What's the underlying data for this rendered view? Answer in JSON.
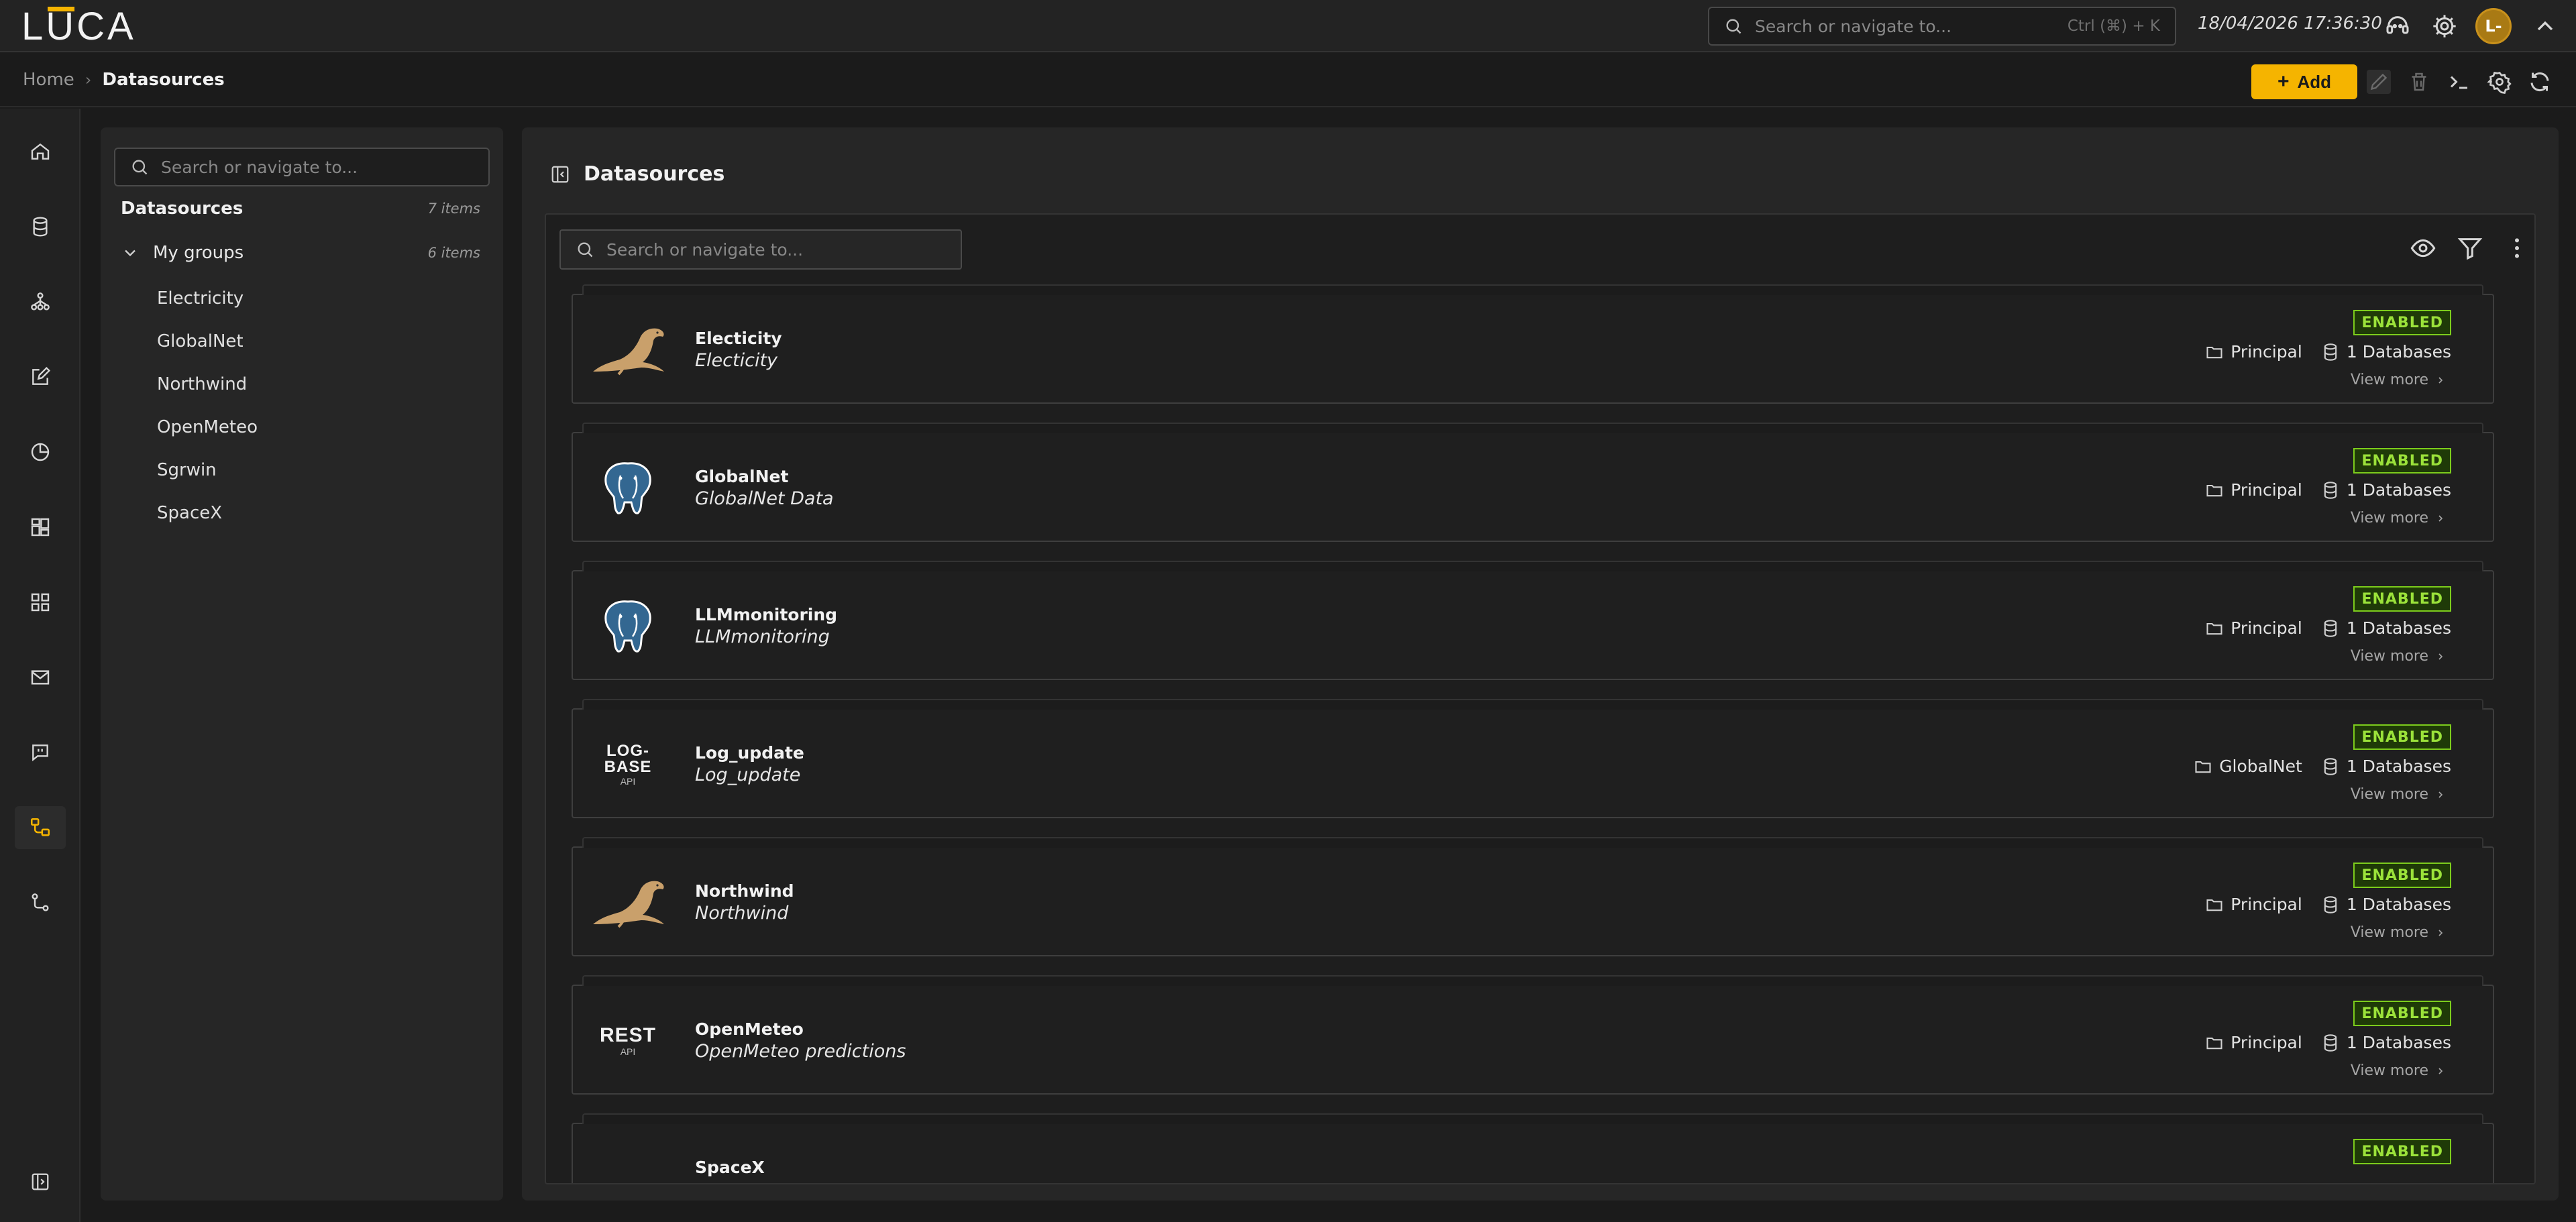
{
  "app": {
    "logo": "LUCA",
    "datetime": "18/04/2026 17:36:30",
    "avatar": "L-"
  },
  "global_search": {
    "placeholder": "Search or navigate to...",
    "shortcut": "Ctrl (⌘) + K"
  },
  "breadcrumb": {
    "home": "Home",
    "separator": "›",
    "current": "Datasources"
  },
  "toolbar": {
    "add_label": "Add"
  },
  "rail": {
    "items": [
      "home-icon",
      "database-icon",
      "hierarchy-icon",
      "edit-icon",
      "pie-chart-icon",
      "dashboard-icon",
      "grid-icon",
      "mail-icon",
      "chat-icon",
      "datasources-icon",
      "workflow-icon"
    ],
    "active": "datasources-icon"
  },
  "tree": {
    "search_placeholder": "Search or navigate to...",
    "root": {
      "label": "Datasources",
      "count": "7 items"
    },
    "group": {
      "label": "My groups",
      "count": "6 items"
    },
    "leaves": [
      "Electricity",
      "GlobalNet",
      "Northwind",
      "OpenMeteo",
      "Sgrwin",
      "SpaceX"
    ]
  },
  "main": {
    "title": "Datasources",
    "search_placeholder": "Search or navigate to...",
    "cards": [
      {
        "name": "Electicity",
        "description": "Electicity",
        "status": "ENABLED",
        "group": "Principal",
        "databases": "1 Databases",
        "view_more": "View more",
        "logo": "mysql-icon"
      },
      {
        "name": "GlobalNet",
        "description": "GlobalNet Data",
        "status": "ENABLED",
        "group": "Principal",
        "databases": "1 Databases",
        "view_more": "View more",
        "logo": "postgresql-icon"
      },
      {
        "name": "LLMmonitoring",
        "description": "LLMmonitoring",
        "status": "ENABLED",
        "group": "Principal",
        "databases": "1 Databases",
        "view_more": "View more",
        "logo": "postgresql-icon"
      },
      {
        "name": "Log_update",
        "description": "Log_update",
        "status": "ENABLED",
        "group": "GlobalNet",
        "databases": "1 Databases",
        "view_more": "View more",
        "logo": "log-base-logo",
        "logo_text": "LOG-BASE",
        "logo_sub": "API"
      },
      {
        "name": "Northwind",
        "description": "Northwind",
        "status": "ENABLED",
        "group": "Principal",
        "databases": "1 Databases",
        "view_more": "View more",
        "logo": "mysql-icon"
      },
      {
        "name": "OpenMeteo",
        "description": "OpenMeteo predictions",
        "status": "ENABLED",
        "group": "Principal",
        "databases": "1 Databases",
        "view_more": "View more",
        "logo": "rest-api-logo",
        "logo_text": "REST",
        "logo_sub": "API"
      },
      {
        "name": "SpaceX",
        "description": "",
        "status": "ENABLED",
        "group": "",
        "databases": "",
        "view_more": "",
        "logo": ""
      }
    ]
  },
  "colors": {
    "accent": "#f5b400",
    "enabled": "#7ccc1c",
    "background": "#1b1b1b",
    "panel": "#262626"
  }
}
